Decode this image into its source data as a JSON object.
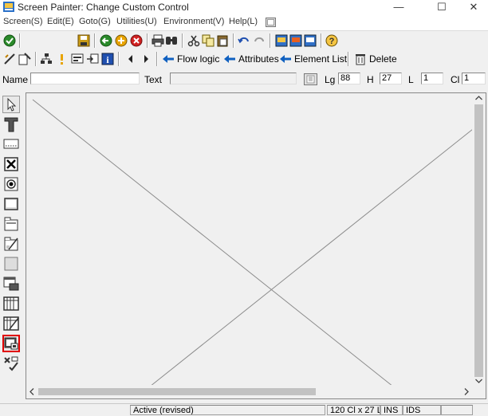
{
  "window": {
    "title": "Screen Painter:  Change Custom Control",
    "min_glyph": "—",
    "max_glyph": "☐",
    "close_glyph": "✕"
  },
  "menu": [
    "Screen(S)",
    "Edit(E)",
    "Goto(G)",
    "Utilities(U)",
    "Environment(V)",
    "Help(L)"
  ],
  "toolbar2": {
    "flow_logic": "Flow logic",
    "attributes": "Attributes",
    "element_list": "Element List",
    "delete": "Delete"
  },
  "attributes": {
    "name_label": "Name",
    "name_value": "",
    "text_label": "Text",
    "text_value": "",
    "lg_label": "Lg",
    "lg_value": "88",
    "h_label": "H",
    "h_value": "27",
    "l_label": "L",
    "l_value": "1",
    "cl_label": "Cl",
    "cl_value": "1"
  },
  "palette": [
    {
      "name": "pointer-tool",
      "selected": false
    },
    {
      "name": "text-field-tool",
      "selected": false
    },
    {
      "name": "input-output-field-tool",
      "selected": false
    },
    {
      "name": "checkbox-tool",
      "selected": false
    },
    {
      "name": "radio-button-tool",
      "selected": false
    },
    {
      "name": "pushbutton-tool",
      "selected": false
    },
    {
      "name": "tabstrip-tool",
      "selected": false
    },
    {
      "name": "tabstrip-wizard-tool",
      "selected": false
    },
    {
      "name": "box-tool",
      "selected": false
    },
    {
      "name": "subscreen-tool",
      "selected": false
    },
    {
      "name": "table-control-tool",
      "selected": false
    },
    {
      "name": "table-control-wizard-tool",
      "selected": false
    },
    {
      "name": "custom-control-tool",
      "selected": true
    },
    {
      "name": "status-icon-tool",
      "selected": false
    }
  ],
  "status": {
    "message": "Active (revised)",
    "size": "120 Cl x 27 L",
    "mode": "INS",
    "system": "IDS"
  },
  "colors": {
    "selection": "#e00000",
    "accent_blue": "#1060c0"
  }
}
